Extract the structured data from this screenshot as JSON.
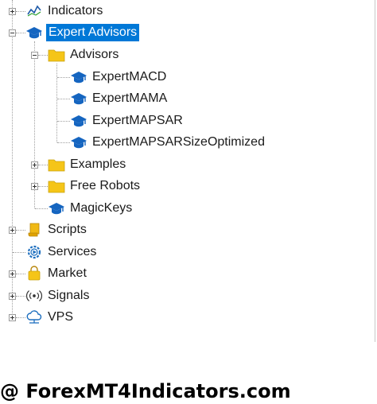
{
  "navigator": {
    "items": {
      "indicators": {
        "label": "Indicators",
        "icon": "indicator-icon"
      },
      "expert_advisors": {
        "label": "Expert Advisors",
        "icon": "expert-advisor-icon"
      },
      "advisors": {
        "label": "Advisors",
        "icon": "folder-icon"
      },
      "expert_macd": {
        "label": "ExpertMACD",
        "icon": "expert-advisor-icon"
      },
      "expert_mama": {
        "label": "ExpertMAMA",
        "icon": "expert-advisor-icon"
      },
      "expert_mapsar": {
        "label": "ExpertMAPSAR",
        "icon": "expert-advisor-icon"
      },
      "expert_mapsar_opt": {
        "label": "ExpertMAPSARSizeOptimized",
        "icon": "expert-advisor-icon"
      },
      "examples": {
        "label": "Examples",
        "icon": "folder-icon"
      },
      "free_robots": {
        "label": "Free Robots",
        "icon": "folder-icon"
      },
      "magickeys": {
        "label": "MagicKeys",
        "icon": "expert-advisor-icon"
      },
      "scripts": {
        "label": "Scripts",
        "icon": "script-scroll-icon"
      },
      "services": {
        "label": "Services",
        "icon": "services-gear-icon"
      },
      "market": {
        "label": "Market",
        "icon": "market-bag-icon"
      },
      "signals": {
        "label": "Signals",
        "icon": "signals-broadcast-icon"
      },
      "vps": {
        "label": "VPS",
        "icon": "vps-cloud-icon"
      }
    },
    "selected": "expert_advisors"
  },
  "watermark": {
    "text": "@ ForexMT4Indicators.com"
  },
  "colors": {
    "selection": "#0078d7",
    "folder": "#f5c518",
    "ea_icon": "#1565c0",
    "text": "#1a1a1a"
  }
}
